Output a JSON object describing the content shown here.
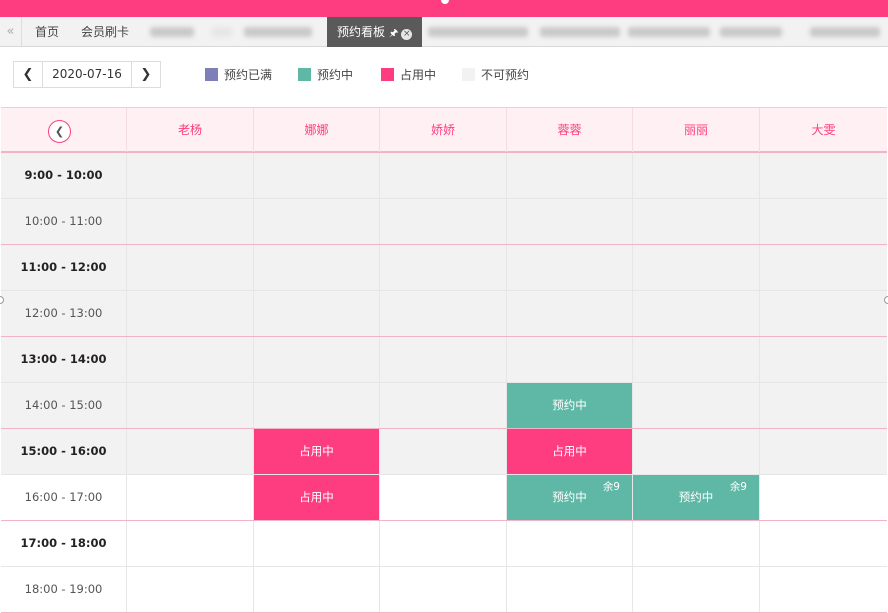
{
  "tabs": [
    {
      "label": "首页"
    },
    {
      "label": "会员刷卡"
    },
    {
      "label": "预约看板",
      "pin": "🖈",
      "close": "×"
    }
  ],
  "toolbar": {
    "prev": "❮",
    "date": "2020-07-16",
    "next": "❯"
  },
  "legend": [
    {
      "label": "预约已满",
      "color": "#7e7fb8"
    },
    {
      "label": "预约中",
      "color": "#5fb8a6"
    },
    {
      "label": "占用中",
      "color": "#fe3d80"
    },
    {
      "label": "不可预约",
      "color": "#f2f2f2"
    }
  ],
  "board": {
    "back": "❮",
    "staff": [
      "老杨",
      "娜娜",
      "娇娇",
      "蓉蓉",
      "丽丽",
      "大雯"
    ],
    "slots": [
      {
        "time": "9:00 - 10:00",
        "bold": true,
        "gray": true
      },
      {
        "time": "10:00 - 11:00",
        "bold": false,
        "gray": true
      },
      {
        "time": "11:00 - 12:00",
        "bold": true,
        "gray": true
      },
      {
        "time": "12:00 - 13:00",
        "bold": false,
        "gray": true
      },
      {
        "time": "13:00 - 14:00",
        "bold": true,
        "gray": true
      },
      {
        "time": "14:00 - 15:00",
        "bold": false,
        "gray": true
      },
      {
        "time": "15:00 - 16:00",
        "bold": true,
        "gray": true
      },
      {
        "time": "16:00 - 17:00",
        "bold": false,
        "gray": false
      },
      {
        "time": "17:00 - 18:00",
        "bold": true,
        "gray": false
      },
      {
        "time": "18:00 - 19:00",
        "bold": false,
        "gray": false
      }
    ],
    "blocks": [
      {
        "slot": 5,
        "staff": 3,
        "kind": "booking",
        "label": "预约中"
      },
      {
        "slot": 6,
        "staff": 1,
        "kind": "busy",
        "label": "占用中"
      },
      {
        "slot": 6,
        "staff": 3,
        "kind": "busy",
        "label": "占用中"
      },
      {
        "slot": 7,
        "staff": 1,
        "kind": "busy",
        "label": "占用中"
      },
      {
        "slot": 7,
        "staff": 3,
        "kind": "booking",
        "label": "预约中",
        "remain": "余9"
      },
      {
        "slot": 7,
        "staff": 4,
        "kind": "booking",
        "label": "预约中",
        "remain": "余9"
      }
    ]
  }
}
